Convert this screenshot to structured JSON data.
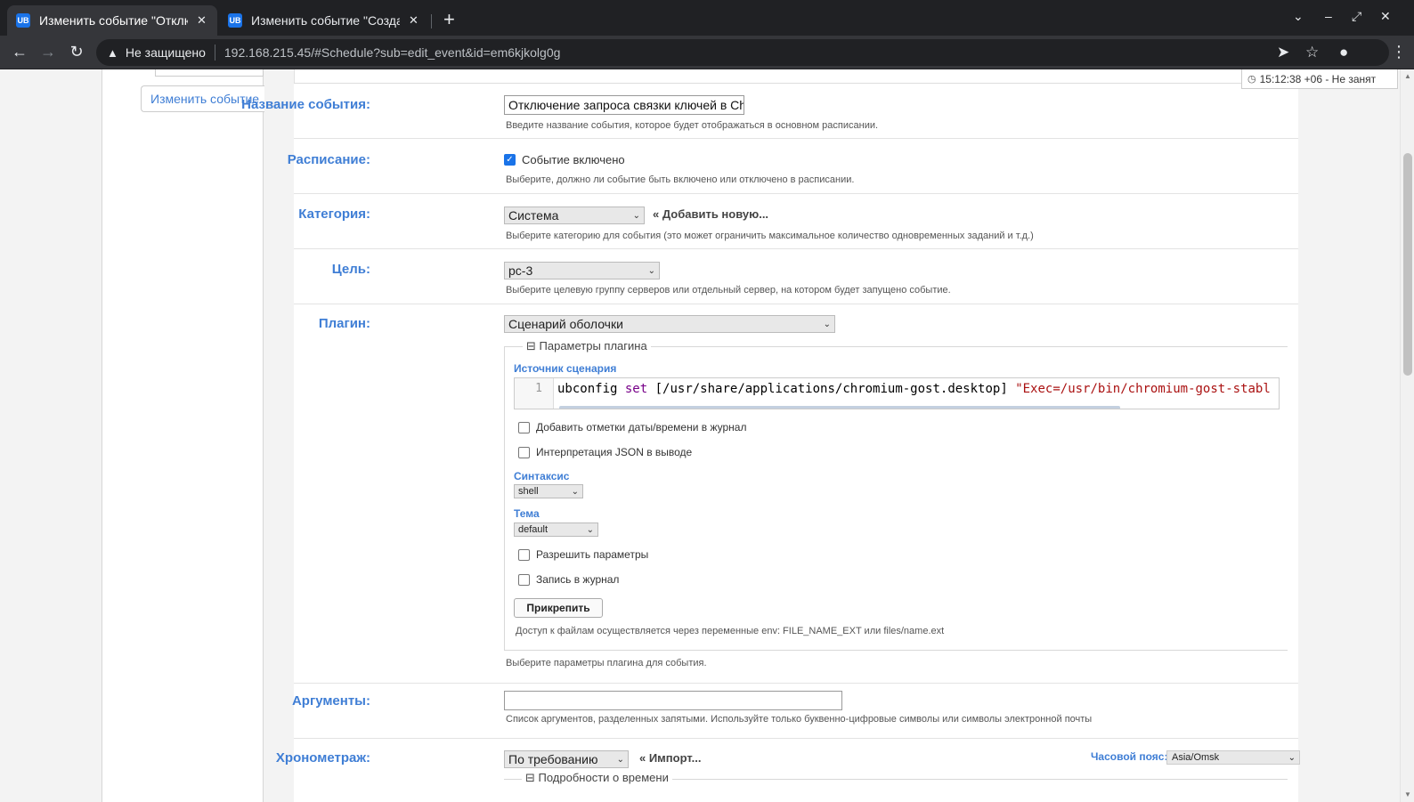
{
  "browser": {
    "tabs": [
      {
        "title": "Изменить событие \"Отключение",
        "active": true
      },
      {
        "title": "Изменить событие \"Создание",
        "active": false
      }
    ],
    "favicon_text": "UB",
    "security_label": "Не защищено",
    "url": "192.168.215.45/#Schedule?sub=edit_event&id=em6kjkolg0g"
  },
  "status": {
    "time": "15:12:38 +06 - Не занят"
  },
  "sidebar": {
    "active_tab": "Изменить событие"
  },
  "form": {
    "title_label": "Название события:",
    "title_value": "Отключение запроса связки ключей в Chr",
    "title_help": "Введите название события, которое будет отображаться в основном расписании.",
    "schedule_label": "Расписание:",
    "schedule_checkbox": "Событие включено",
    "schedule_checked": true,
    "schedule_help": "Выберите, должно ли событие быть включено или отключено в расписании.",
    "category_label": "Категория:",
    "category_value": "Система",
    "category_add": "« Добавить новую...",
    "category_help": "Выберите категорию для события (это может ограничить максимальное количество одновременных заданий и т.д.)",
    "target_label": "Цель:",
    "target_value": "pc-3",
    "target_help": "Выберите целевую группу серверов или отдельный сервер, на котором будет запущено событие.",
    "plugin_label": "Плагин:",
    "plugin_value": "Сценарий оболочки",
    "plugin_params_legend": "Параметры плагина",
    "script_source_label": "Источник сценария",
    "code": {
      "line_number": "1",
      "cmd": "ubconfig",
      "kw": "set",
      "path": "[/usr/share/applications/chromium-gost.desktop]",
      "str": "\"Exec=/usr/bin/chromium-gost-stabl"
    },
    "opt_timestamps": "Добавить отметки даты/времени в журнал",
    "opt_json": "Интерпретация JSON в выводе",
    "syntax_label": "Синтаксис",
    "syntax_value": "shell",
    "theme_label": "Тема",
    "theme_value": "default",
    "opt_allow_params": "Разрешить параметры",
    "opt_log": "Запись в журнал",
    "attach_button": "Прикрепить",
    "files_note": "Доступ к файлам осуществляется через переменные env: FILE_NAME_EXT или files/name.ext",
    "plugin_help": "Выберите параметры плагина для события.",
    "args_label": "Аргументы:",
    "args_value": "",
    "args_help": "Список аргументов, разделенных запятыми. Используйте только буквенно-цифровые символы или символы электронной почты",
    "timing_label": "Хронометраж:",
    "timing_value": "По требованию",
    "timing_import": "« Импорт...",
    "tz_label": "Часовой пояс:",
    "tz_value": "Asia/Omsk",
    "time_details_legend": "Подробности о времени"
  }
}
